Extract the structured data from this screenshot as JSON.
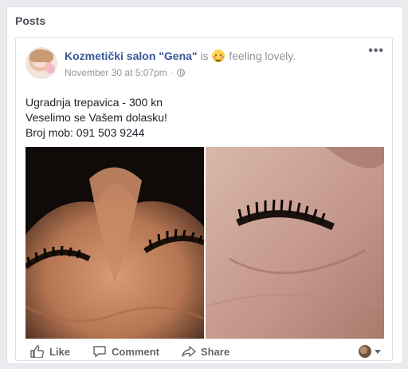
{
  "section": {
    "title": "Posts"
  },
  "post": {
    "author": "Kozmetički salon \"Gena\"",
    "is_word": "is",
    "feeling_emoji": "blushing-smile-emoji",
    "feeling_text": "feeling lovely.",
    "timestamp": "November 30 at 5:07pm",
    "separator": "·",
    "privacy_icon": "globe-icon",
    "more_icon": "more-options-icon",
    "more_label": "•••",
    "body_lines": [
      "Ugradnja trepavica - 300 kn",
      "Veselimo se Vašem dolasku!",
      "Broj mob: 091 503 9244"
    ],
    "photos": [
      {
        "name": "eyelash-photo-left"
      },
      {
        "name": "eyelash-photo-right"
      }
    ]
  },
  "actions": {
    "like_label": "Like",
    "comment_label": "Comment",
    "share_label": "Share",
    "like_icon": "thumbs-up-icon",
    "comment_icon": "comment-bubble-icon",
    "share_icon": "share-arrow-icon",
    "audience_icon": "page-avatar-selector"
  },
  "colors": {
    "page_background": "#e9ebee",
    "link_blue": "#365899",
    "muted_text": "#90949c",
    "action_text": "#606770"
  }
}
